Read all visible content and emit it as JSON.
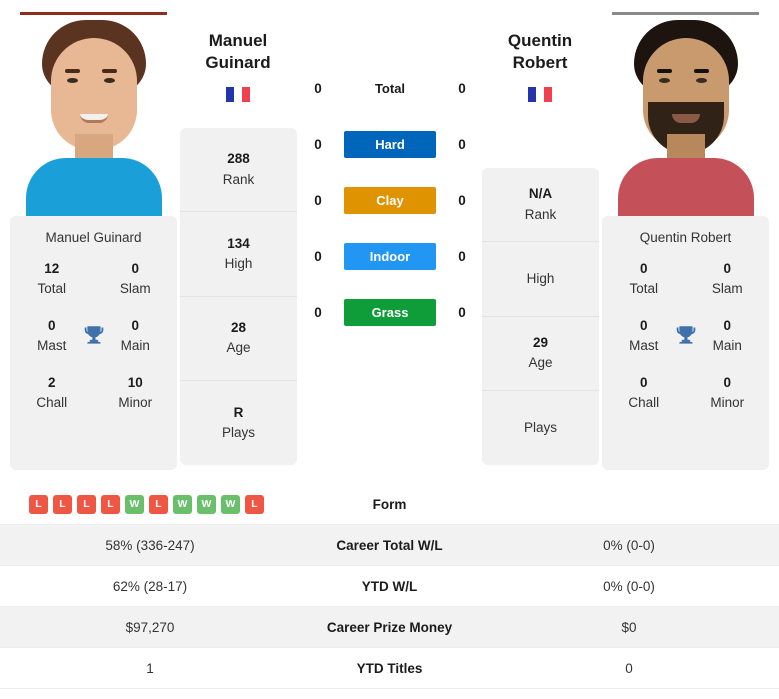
{
  "players": {
    "left": {
      "first_name": "Manuel",
      "last_name": "Guinard",
      "caption_name": "Manuel Guinard",
      "flag": "france-flag",
      "accent_color": "#8f2d20",
      "info": [
        {
          "value": "288",
          "label": "Rank"
        },
        {
          "value": "134",
          "label": "High"
        },
        {
          "value": "28",
          "label": "Age"
        },
        {
          "value": "R",
          "label": "Plays"
        }
      ],
      "titles": [
        {
          "value": "12",
          "label": "Total"
        },
        {
          "value": "0",
          "label": "Slam"
        },
        {
          "value": "0",
          "label": "Mast"
        },
        {
          "value": "0",
          "label": "Main"
        },
        {
          "value": "2",
          "label": "Chall"
        },
        {
          "value": "10",
          "label": "Minor"
        }
      ],
      "surface_values": {
        "total": "0",
        "hard": "0",
        "clay": "0",
        "indoor": "0",
        "grass": "0"
      }
    },
    "right": {
      "first_name": "Quentin",
      "last_name": "Robert",
      "caption_name": "Quentin Robert",
      "flag": "france-flag",
      "accent_color": "#8a8a8a",
      "info": [
        {
          "value": "N/A",
          "label": "Rank"
        },
        {
          "value": "",
          "label": "High"
        },
        {
          "value": "29",
          "label": "Age"
        },
        {
          "value": "",
          "label": "Plays"
        }
      ],
      "titles": [
        {
          "value": "0",
          "label": "Total"
        },
        {
          "value": "0",
          "label": "Slam"
        },
        {
          "value": "0",
          "label": "Mast"
        },
        {
          "value": "0",
          "label": "Main"
        },
        {
          "value": "0",
          "label": "Chall"
        },
        {
          "value": "0",
          "label": "Minor"
        }
      ],
      "surface_values": {
        "total": "0",
        "hard": "0",
        "clay": "0",
        "indoor": "0",
        "grass": "0"
      }
    }
  },
  "surfaces": [
    {
      "key": "total",
      "label": "Total",
      "color": "transparent",
      "plain": true
    },
    {
      "key": "hard",
      "label": "Hard",
      "color": "#0066bb",
      "plain": false
    },
    {
      "key": "clay",
      "label": "Clay",
      "color": "#e09300",
      "plain": false
    },
    {
      "key": "indoor",
      "label": "Indoor",
      "color": "#2196f3",
      "plain": false
    },
    {
      "key": "grass",
      "label": "Grass",
      "color": "#0f9d3a",
      "plain": false
    }
  ],
  "table": {
    "form_label": "Form",
    "left_form": [
      "L",
      "L",
      "L",
      "L",
      "W",
      "L",
      "W",
      "W",
      "W",
      "L"
    ],
    "rows": [
      {
        "label": "Career Total W/L",
        "left": "58% (336-247)",
        "right": "0% (0-0)"
      },
      {
        "label": "YTD W/L",
        "left": "62% (28-17)",
        "right": "0% (0-0)"
      },
      {
        "label": "Career Prize Money",
        "left": "$97,270",
        "right": "$0"
      },
      {
        "label": "YTD Titles",
        "left": "1",
        "right": "0"
      }
    ]
  },
  "colors": {
    "win_badge": "#6abf6a",
    "loss_badge": "#ef5744",
    "card_bg": "#f1f1f1",
    "row_shade": "#f2f2f2"
  }
}
